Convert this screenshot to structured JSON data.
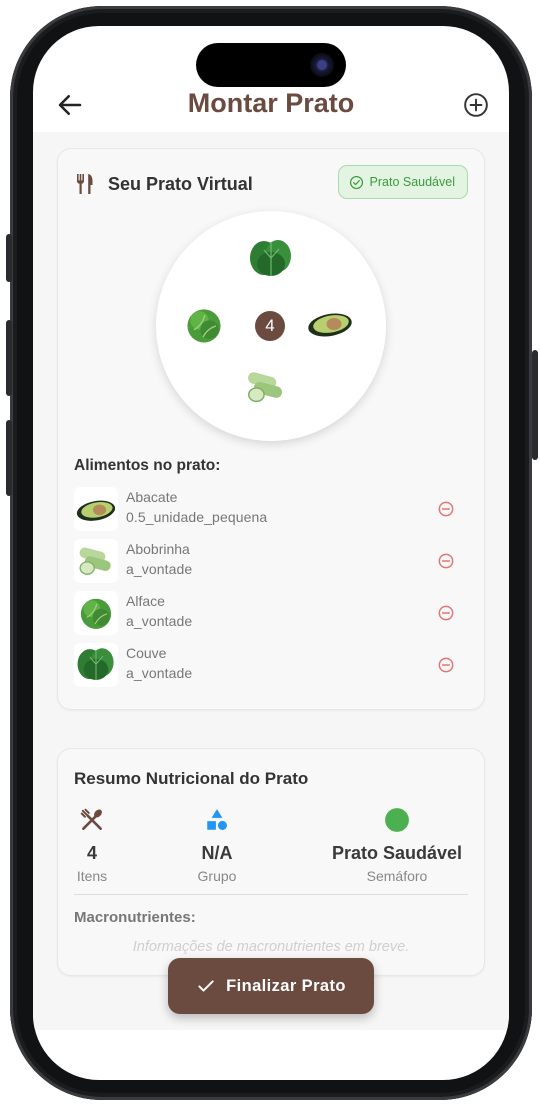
{
  "header": {
    "title": "Montar Prato"
  },
  "plate_card": {
    "title": "Seu Prato Virtual",
    "badge": "Prato Saudável",
    "item_count": "4",
    "list_heading": "Alimentos no prato:",
    "items": [
      {
        "name": "Abacate",
        "quantity": "0.5_unidade_pequena"
      },
      {
        "name": "Abobrinha",
        "quantity": "a_vontade"
      },
      {
        "name": "Alface",
        "quantity": "a_vontade"
      },
      {
        "name": "Couve",
        "quantity": "a_vontade"
      }
    ]
  },
  "summary": {
    "title": "Resumo Nutricional do Prato",
    "stats": [
      {
        "value": "4",
        "label": "Itens"
      },
      {
        "value": "N/A",
        "label": "Grupo"
      },
      {
        "value": "Prato Saudável",
        "label": "Semáforo"
      }
    ],
    "macro_title": "Macronutrientes:",
    "macro_note": "Informações de macronutrientes em breve."
  },
  "fab": {
    "label": "Finalizar Prato"
  },
  "colors": {
    "brand": "#6b4a3f",
    "healthy": "#4caf50",
    "group_icon": "#2196f3",
    "remove": "#e57373"
  },
  "icons": [
    "back-arrow-icon",
    "add-circle-icon",
    "restaurant-icon",
    "check-circle-icon",
    "remove-circle-icon",
    "utensils-icon",
    "category-icon",
    "traffic-light-icon",
    "check-icon"
  ]
}
